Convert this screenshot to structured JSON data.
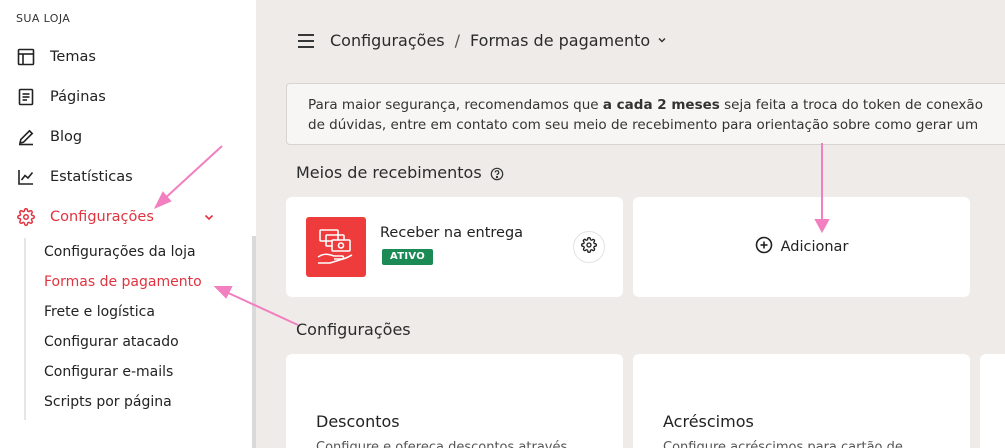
{
  "sidebar": {
    "section_label": "SUA LOJA",
    "items": [
      {
        "label": "Temas",
        "icon": "layout-icon"
      },
      {
        "label": "Páginas",
        "icon": "document-icon"
      },
      {
        "label": "Blog",
        "icon": "pencil-icon"
      },
      {
        "label": "Estatísticas",
        "icon": "chart-line-icon"
      },
      {
        "label": "Configurações",
        "icon": "gear-icon",
        "active": true
      }
    ],
    "submenu": [
      {
        "label": "Configurações da loja"
      },
      {
        "label": "Formas de pagamento",
        "active": true
      },
      {
        "label": "Frete e logística"
      },
      {
        "label": "Configurar atacado"
      },
      {
        "label": "Configurar e-mails"
      },
      {
        "label": "Scripts por página"
      }
    ]
  },
  "header": {
    "breadcrumb_root": "Configurações",
    "breadcrumb_separator": "/",
    "breadcrumb_current": "Formas de pagamento"
  },
  "notice": {
    "line1_before": "Para maior segurança, recomendamos que ",
    "line1_bold": "a cada 2 meses",
    "line1_after": " seja feita a troca do token de conexão",
    "line2": "de dúvidas, entre em contato com seu meio de recebimento para orientação sobre como gerar um"
  },
  "payment_section": {
    "title": "Meios de recebimentos",
    "method": {
      "name": "Receber na entrega",
      "status": "ATIVO"
    },
    "add_label": "Adicionar"
  },
  "config_section": {
    "title": "Configurações",
    "cards": [
      {
        "title": "Descontos",
        "desc": "Configure e ofereça descontos através"
      },
      {
        "title": "Acréscimos",
        "desc": "Configure acréscimos para cartão de"
      }
    ]
  },
  "colors": {
    "accent": "#e0333f",
    "badge": "#1b8a55",
    "logo_bg": "#ee3b3b",
    "annotation_arrow": "#f27fbf"
  }
}
